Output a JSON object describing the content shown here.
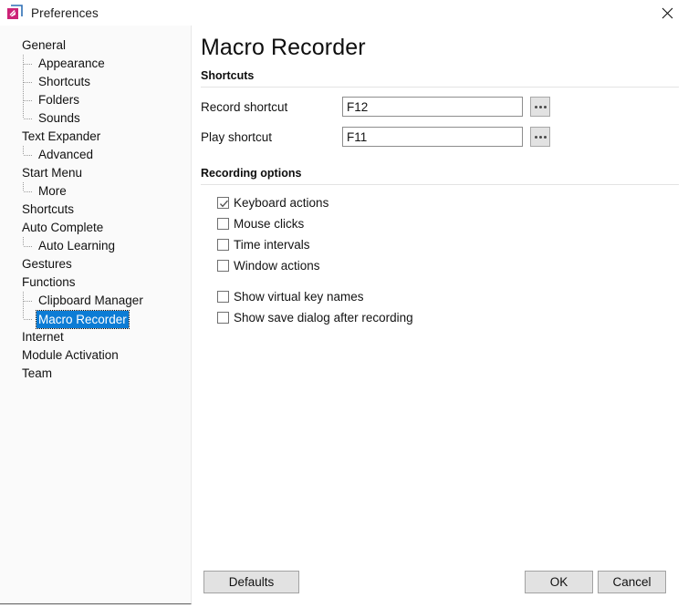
{
  "window": {
    "title": "Preferences",
    "icon": "app-icon",
    "close_label": "✕"
  },
  "sidebar": {
    "items": [
      {
        "label": "General",
        "level": 0,
        "selected": false,
        "last": false
      },
      {
        "label": "Appearance",
        "level": 1,
        "selected": false,
        "last": false
      },
      {
        "label": "Shortcuts",
        "level": 1,
        "selected": false,
        "last": false
      },
      {
        "label": "Folders",
        "level": 1,
        "selected": false,
        "last": false
      },
      {
        "label": "Sounds",
        "level": 1,
        "selected": false,
        "last": true
      },
      {
        "label": "Text Expander",
        "level": 0,
        "selected": false,
        "last": false
      },
      {
        "label": "Advanced",
        "level": 1,
        "selected": false,
        "last": true
      },
      {
        "label": "Start Menu",
        "level": 0,
        "selected": false,
        "last": false
      },
      {
        "label": "More",
        "level": 1,
        "selected": false,
        "last": true
      },
      {
        "label": "Shortcuts",
        "level": 0,
        "selected": false,
        "last": false
      },
      {
        "label": "Auto Complete",
        "level": 0,
        "selected": false,
        "last": false
      },
      {
        "label": "Auto Learning",
        "level": 1,
        "selected": false,
        "last": true
      },
      {
        "label": "Gestures",
        "level": 0,
        "selected": false,
        "last": false
      },
      {
        "label": "Functions",
        "level": 0,
        "selected": false,
        "last": false
      },
      {
        "label": "Clipboard Manager",
        "level": 1,
        "selected": false,
        "last": false
      },
      {
        "label": "Macro Recorder",
        "level": 1,
        "selected": true,
        "last": true
      },
      {
        "label": "Internet",
        "level": 0,
        "selected": false,
        "last": false
      },
      {
        "label": "Module Activation",
        "level": 0,
        "selected": false,
        "last": false
      },
      {
        "label": "Team",
        "level": 0,
        "selected": false,
        "last": false
      }
    ]
  },
  "main": {
    "page_title": "Macro Recorder",
    "sections": {
      "shortcuts": {
        "heading": "Shortcuts",
        "fields": [
          {
            "label": "Record shortcut",
            "value": "F12",
            "placeholder": "",
            "browse": "..."
          },
          {
            "label": "Play shortcut",
            "value": "F11",
            "placeholder": "",
            "browse": "..."
          }
        ]
      },
      "recording_options": {
        "heading": "Recording options",
        "checkboxes": [
          {
            "label": "Keyboard actions",
            "checked": true
          },
          {
            "label": "Mouse clicks",
            "checked": false
          },
          {
            "label": "Time intervals",
            "checked": false
          },
          {
            "label": "Window actions",
            "checked": false
          },
          {
            "label": "Show virtual key names",
            "checked": false
          },
          {
            "label": "Show save dialog after recording",
            "checked": false
          }
        ]
      }
    }
  },
  "footer": {
    "defaults_label": "Defaults",
    "ok_label": "OK",
    "cancel_label": "Cancel"
  },
  "colors": {
    "selection_blue": "#0c7cd5",
    "accent_pink": "#cc2277",
    "accent_blue": "#2e6fb5",
    "sidebar_bg": "#fafafa",
    "button_bg": "#e2e2e2"
  }
}
